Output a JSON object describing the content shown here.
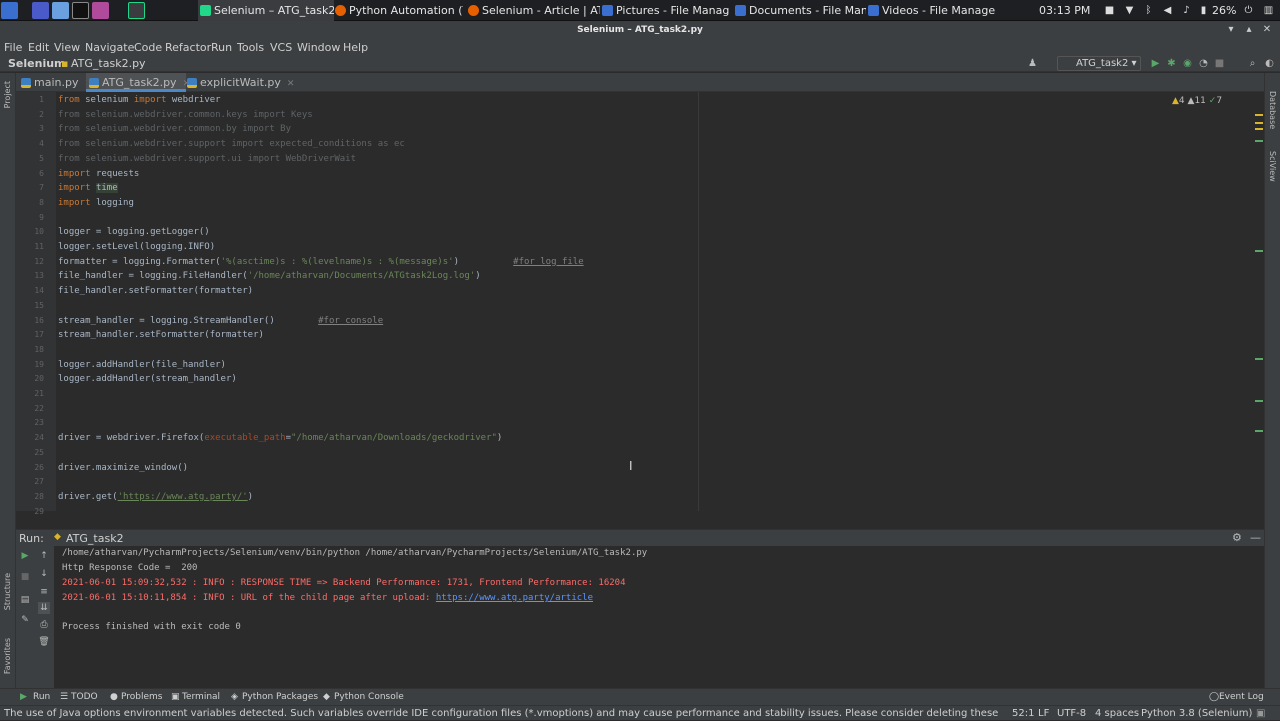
{
  "taskbar": {
    "tasks": [
      {
        "label": "Selenium – ATG_task2.py",
        "active": true
      },
      {
        "label": "Python Automation (Tas..."
      },
      {
        "label": "Selenium - Article | ATG..."
      },
      {
        "label": "Pictures - File Manager"
      },
      {
        "label": "Documents - File Manag..."
      },
      {
        "label": "Videos - File Manager"
      }
    ],
    "clock": "03:13 PM",
    "battery": "26%"
  },
  "window": {
    "title": "Selenium – ATG_task2.py"
  },
  "menu": [
    "File",
    "Edit",
    "View",
    "Navigate",
    "Code",
    "Refactor",
    "Run",
    "Tools",
    "VCS",
    "Window",
    "Help"
  ],
  "nav": {
    "project": "Selenium",
    "file": "ATG_task2.py",
    "run_config": "ATG_task2"
  },
  "tabs": [
    "main.py",
    "ATG_task2.py",
    "explicitWait.py"
  ],
  "left_strip": {
    "project": "Project",
    "structure": "Structure",
    "favorites": "Favorites"
  },
  "right_strip": {
    "database": "Database",
    "sciview": "SciView"
  },
  "inspections": {
    "warnings": "4",
    "weak": "11",
    "ok": "7"
  },
  "line_numbers": [
    "1",
    "2",
    "3",
    "4",
    "5",
    "6",
    "7",
    "8",
    "9",
    "10",
    "11",
    "12",
    "13",
    "14",
    "15",
    "16",
    "17",
    "18",
    "19",
    "20",
    "21",
    "22",
    "23",
    "24",
    "25",
    "26",
    "27",
    "28",
    "29"
  ],
  "code": {
    "l1": [
      "from",
      "selenium",
      "import",
      "webdriver"
    ],
    "l2": "from selenium.webdriver.common.keys import Keys",
    "l3": "from selenium.webdriver.common.by import By",
    "l4": "from selenium.webdriver.support import expected_conditions as ec",
    "l5": "from selenium.webdriver.support.ui import WebDriverWait",
    "l6": [
      "import",
      "requests"
    ],
    "l7": [
      "import",
      "time"
    ],
    "l8": [
      "import",
      "logging"
    ],
    "l10": "logger = logging.getLogger()",
    "l11": "logger.setLevel(logging.INFO)",
    "l12": [
      "formatter = logging.Formatter(",
      "'%(asctime)s : %(levelname)s : %(message)s'",
      ")",
      "#for log file"
    ],
    "l13": [
      "file_handler = logging.FileHandler(",
      "'/home/atharvan/Documents/ATGtask2Log.log'",
      ")"
    ],
    "l14": "file_handler.setFormatter(formatter)",
    "l16": [
      "stream_handler = logging.StreamHandler()",
      "#for console"
    ],
    "l17": "stream_handler.setFormatter(formatter)",
    "l19": "logger.addHandler(file_handler)",
    "l20": "logger.addHandler(stream_handler)",
    "l24": [
      "driver = webdriver.Firefox(",
      "executable_path",
      "=",
      "\"/home/atharvan/Downloads/geckodriver\"",
      ")"
    ],
    "l26": "driver.maximize_window()",
    "l28": [
      "driver.get(",
      "'https://www.atg.party/'",
      ")"
    ]
  },
  "run": {
    "label": "Run:",
    "tab": "ATG_task2",
    "output": [
      "/home/atharvan/PycharmProjects/Selenium/venv/bin/python /home/atharvan/PycharmProjects/Selenium/ATG_task2.py",
      "Http Response Code =  200",
      "2021-06-01 15:09:32,532 : INFO : RESPONSE TIME => Backend Performance: 1731, Frontend Performance: 16204",
      "2021-06-01 15:10:11,854 : INFO : URL of the child page after upload: ",
      "https://www.atg.party/article",
      "Process finished with exit code 0"
    ]
  },
  "bottom_tabs": [
    "Run",
    "TODO",
    "Problems",
    "Terminal",
    "Python Packages",
    "Python Console",
    "Event Log"
  ],
  "status": {
    "message": "The use of Java options environment variables detected. Such variables override IDE configuration files (*.vmoptions) and may cause performance and stability issues. Please consider deleting these vari... (8 minutes ago)",
    "position": "52:1",
    "line_sep": "LF",
    "encoding": "UTF-8",
    "indent": "4 spaces",
    "interpreter": "Python 3.8 (Selenium)"
  }
}
